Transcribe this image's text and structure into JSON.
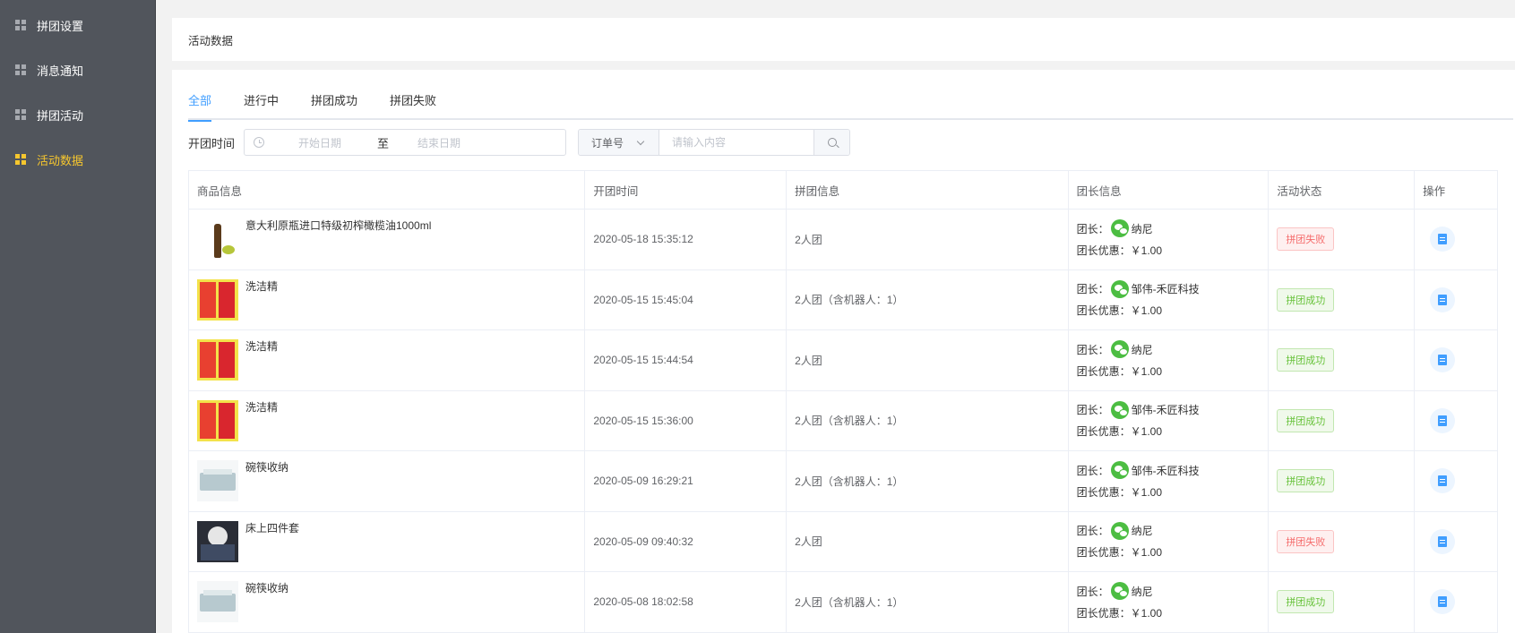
{
  "sidebar": {
    "items": [
      {
        "label": "拼团设置",
        "active": false
      },
      {
        "label": "消息通知",
        "active": false
      },
      {
        "label": "拼团活动",
        "active": false
      },
      {
        "label": "活动数据",
        "active": true
      }
    ]
  },
  "header": {
    "title": "活动数据"
  },
  "tabs": [
    {
      "label": "全部",
      "active": true
    },
    {
      "label": "进行中",
      "active": false
    },
    {
      "label": "拼团成功",
      "active": false
    },
    {
      "label": "拼团失败",
      "active": false
    }
  ],
  "filter": {
    "time_label": "开团时间",
    "start_placeholder": "开始日期",
    "separator": "至",
    "end_placeholder": "结束日期",
    "select_value": "订单号",
    "search_placeholder": "请输入内容"
  },
  "table": {
    "columns": [
      "商品信息",
      "开团时间",
      "拼团信息",
      "团长信息",
      "活动状态",
      "操作"
    ],
    "leader_prefix": "团长：",
    "discount_prefix": "团长优惠：",
    "rows": [
      {
        "image": "olive-oil-bottle",
        "name": "意大利原瓶进口特级初榨橄榄油1000ml",
        "time": "2020-05-18 15:35:12",
        "group": "2人团",
        "leader": "纳尼",
        "discount": "￥1.00",
        "status": "拼团失败",
        "status_type": "fail"
      },
      {
        "image": "detergent-pack",
        "name": "洗洁精",
        "time": "2020-05-15 15:45:04",
        "group": "2人团（含机器人：1）",
        "leader": "邹伟-禾匠科技",
        "discount": "￥1.00",
        "status": "拼团成功",
        "status_type": "ok"
      },
      {
        "image": "detergent-pack",
        "name": "洗洁精",
        "time": "2020-05-15 15:44:54",
        "group": "2人团",
        "leader": "纳尼",
        "discount": "￥1.00",
        "status": "拼团成功",
        "status_type": "ok"
      },
      {
        "image": "detergent-pack",
        "name": "洗洁精",
        "time": "2020-05-15 15:36:00",
        "group": "2人团（含机器人：1）",
        "leader": "邹伟-禾匠科技",
        "discount": "￥1.00",
        "status": "拼团成功",
        "status_type": "ok"
      },
      {
        "image": "dish-rack",
        "name": "碗筷收纳",
        "time": "2020-05-09 16:29:21",
        "group": "2人团（含机器人：1）",
        "leader": "邹伟-禾匠科技",
        "discount": "￥1.00",
        "status": "拼团成功",
        "status_type": "ok"
      },
      {
        "image": "bedding-set",
        "name": "床上四件套",
        "time": "2020-05-09 09:40:32",
        "group": "2人团",
        "leader": "纳尼",
        "discount": "￥1.00",
        "status": "拼团失败",
        "status_type": "fail"
      },
      {
        "image": "dish-rack",
        "name": "碗筷收纳",
        "time": "2020-05-08 18:02:58",
        "group": "2人团（含机器人：1）",
        "leader": "纳尼",
        "discount": "￥1.00",
        "status": "拼团成功",
        "status_type": "ok"
      }
    ]
  },
  "colors": {
    "active_nav": "#f7c72e",
    "primary": "#409eff",
    "success": "#67c23a",
    "danger": "#f56c6c",
    "sidebar_bg": "#51555c"
  }
}
